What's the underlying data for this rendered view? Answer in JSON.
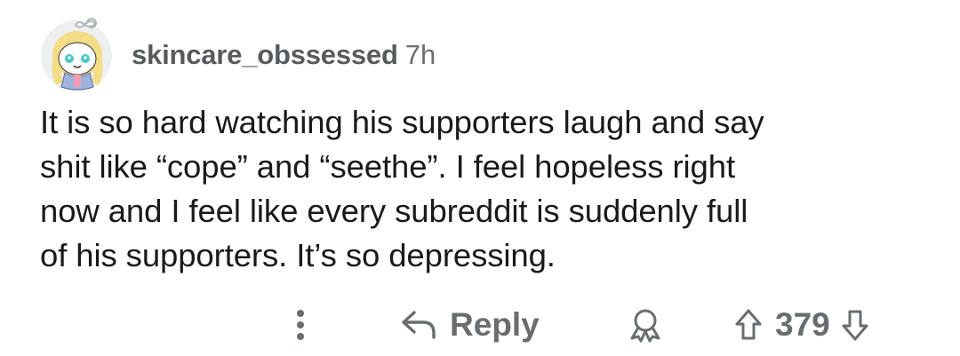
{
  "comment": {
    "username": "skincare_obssessed",
    "time": "7h",
    "body_lines": [
      "It is so hard watching his supporters laugh and say",
      "shit like “cope” and “seethe”. I feel hopeless right",
      "now and I feel like every subreddit is suddenly full",
      "of his supporters. It’s so depressing."
    ]
  },
  "actions": {
    "more_icon": "vertical-ellipsis",
    "reply_icon": "reply-arrow",
    "reply_label": "Reply",
    "award_icon": "award-ribbon",
    "upvote_icon": "up-arrow",
    "score": "379",
    "downvote_icon": "down-arrow"
  },
  "colors": {
    "text": "#1a1a1b",
    "meta": "#606366",
    "action": "#6a6d70",
    "avatar_bg": "#edeff1"
  }
}
